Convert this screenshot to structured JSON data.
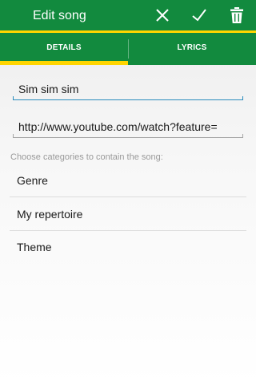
{
  "action_bar": {
    "title": "Edit song",
    "discard_icon": "close-icon",
    "save_icon": "check-icon",
    "delete_icon": "trash-icon"
  },
  "tabs": [
    {
      "label": "DETAILS",
      "selected": true
    },
    {
      "label": "LYRICS",
      "selected": false
    }
  ],
  "form": {
    "song_title": "Sim sim sim",
    "video_url": "http://www.youtube.com/watch?feature="
  },
  "categories": {
    "label": "Choose categories to contain the song:",
    "items": [
      "Genre",
      "My repertoire",
      "Theme"
    ]
  },
  "colors": {
    "primary": "#128a3e",
    "accent": "#ffd500",
    "focus": "#2a8bbd"
  }
}
